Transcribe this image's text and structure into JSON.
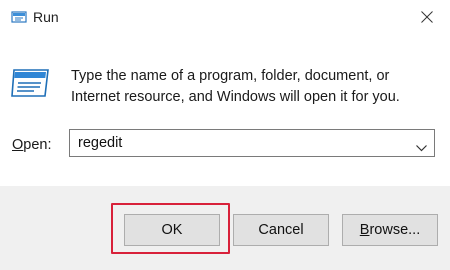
{
  "window": {
    "title": "Run",
    "close_icon": "close-icon",
    "app_icon": "run-icon"
  },
  "content": {
    "description_line1": "Type the name of a program, folder, document, or",
    "description_line2": "Internet resource, and Windows will open it for you.",
    "open_label_accel": "O",
    "open_label_rest": "pen:",
    "command_value": "regedit"
  },
  "buttons": {
    "ok": "OK",
    "cancel": "Cancel",
    "browse_accel": "B",
    "browse_rest": "rowse..."
  },
  "colors": {
    "highlight": "#d8213a",
    "footer_bg": "#f0f0f0",
    "button_bg": "#e1e1e1"
  }
}
